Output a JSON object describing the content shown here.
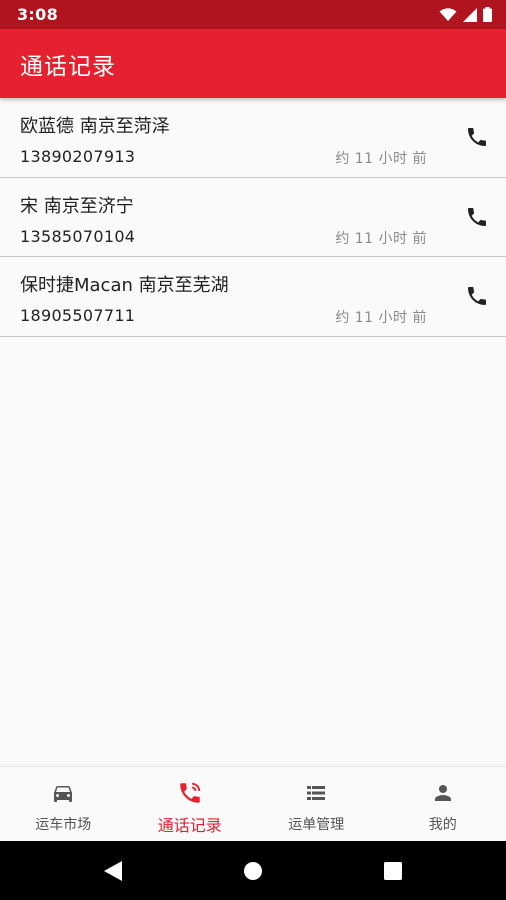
{
  "status_bar": {
    "time": "3:08"
  },
  "app_bar": {
    "title": "通话记录"
  },
  "calls": [
    {
      "title": "欧蓝德 南京至菏泽",
      "phone": "13890207913",
      "time": "约 11 小时 前"
    },
    {
      "title": "宋 南京至济宁",
      "phone": "13585070104",
      "time": "约 11 小时 前"
    },
    {
      "title": "保时捷Macan 南京至芜湖",
      "phone": "18905507711",
      "time": "约 11 小时 前"
    }
  ],
  "bottom_nav": {
    "items": [
      {
        "label": "运车市场",
        "icon": "car-icon"
      },
      {
        "label": "通话记录",
        "icon": "phone-ringing-icon",
        "active": true
      },
      {
        "label": "运单管理",
        "icon": "list-icon"
      },
      {
        "label": "我的",
        "icon": "person-icon"
      }
    ]
  },
  "colors": {
    "status_bar": "#b0151f",
    "primary": "#e5202f",
    "inactive": "#555555"
  }
}
